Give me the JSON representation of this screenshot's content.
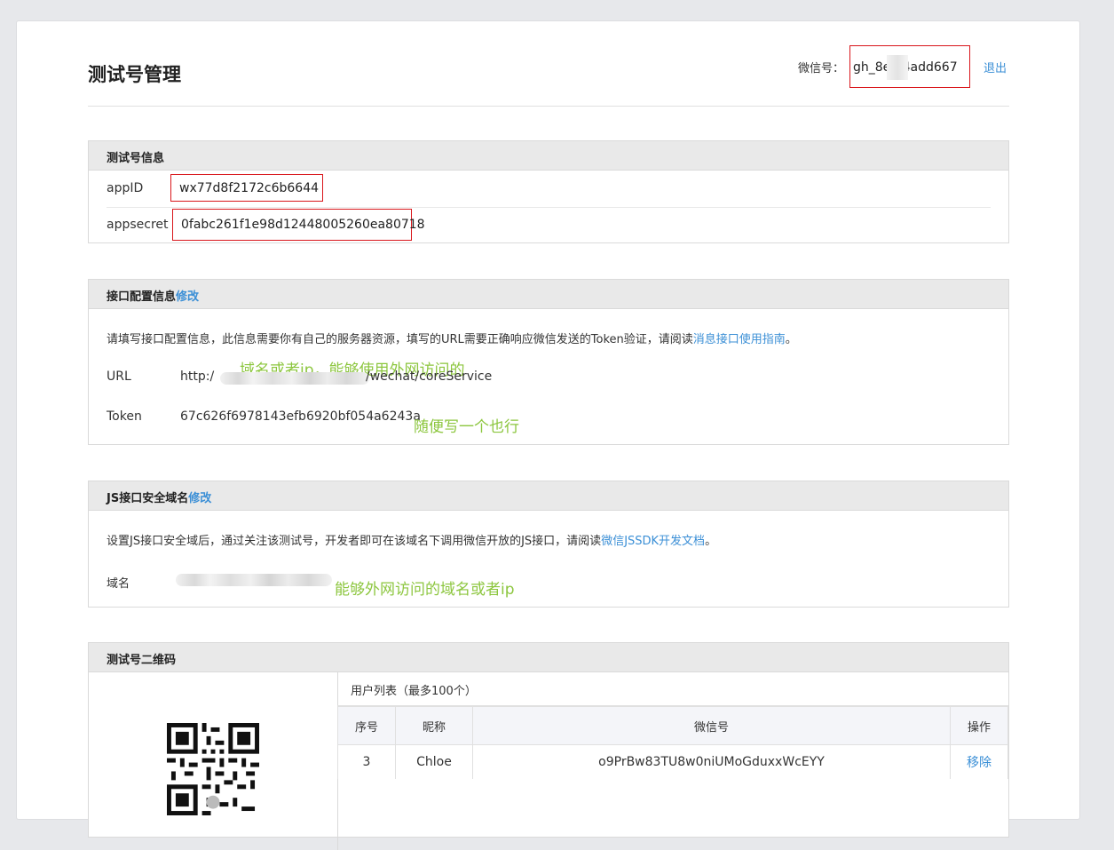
{
  "header": {
    "title": "测试号管理",
    "wx_label": "微信号：",
    "wx_value": "gh_8e    04add667",
    "logout": "退出"
  },
  "test_info": {
    "title": "测试号信息",
    "appid_label": "appID",
    "appid_value": "wx77d8f2172c6b6644",
    "appsecret_label": "appsecret",
    "appsecret_value": "0fabc261f1e98d12448005260ea80718"
  },
  "api_config": {
    "title": "接口配置信息",
    "modify": "修改",
    "desc_prefix": "请填写接口配置信息，此信息需要你有自己的服务器资源，填写的URL需要正确响应微信发送的Token验证，请阅读",
    "desc_link": "消息接口使用指南",
    "desc_suffix": "。",
    "url_label": "URL",
    "url_prefix": "http:/",
    "url_suffix": "/wechat/coreService",
    "url_note": "域名或者ip，能够使用外网访问的",
    "token_label": "Token",
    "token_value": "67c626f6978143efb6920bf054a6243a",
    "token_note": "随便写一个也行"
  },
  "js_domain": {
    "title": "JS接口安全域名",
    "modify": "修改",
    "desc_prefix": "设置JS接口安全域后，通过关注该测试号，开发者即可在该域名下调用微信开放的JS接口，请阅读",
    "desc_link": "微信JSSDK开发文档",
    "desc_suffix": "。",
    "domain_label": "域名",
    "domain_note": "能够外网访问的域名或者ip"
  },
  "qrcode": {
    "title": "测试号二维码",
    "user_list_title": "用户列表（最多100个）",
    "columns": [
      "序号",
      "昵称",
      "微信号",
      "操作"
    ],
    "rows": [
      {
        "index": "3",
        "nickname": "Chloe",
        "wechat_id": "o9PrBw83TU8w0niUMoGduxxWcEYY",
        "action": "移除"
      }
    ]
  },
  "colors": {
    "accent": "#3b8fd6",
    "highlight_box": "#d9161b",
    "annotation": "#8cc63e"
  }
}
